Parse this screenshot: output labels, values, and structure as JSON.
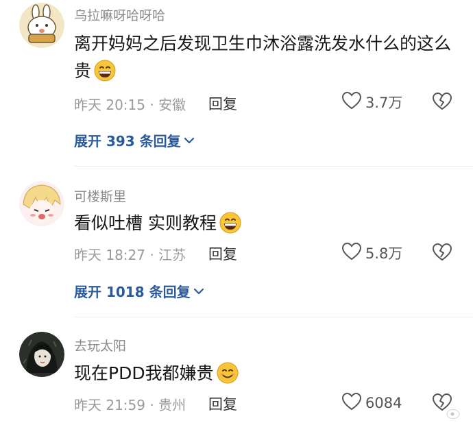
{
  "comments": [
    {
      "username": "乌拉嘛呀哈呀哈",
      "text": "离开妈妈之后发现卫生巾沐浴露洗发水什么的这么贵",
      "time_location": "昨天 20:15 · 安徽",
      "reply_label": "回复",
      "likes": "3.7万",
      "expand_label": "展开 393 条回复",
      "emoji": "grinning-face-icon"
    },
    {
      "username": "可楼斯里",
      "text": "看似吐槽 实则教程",
      "time_location": "昨天 18:27 · 江苏",
      "reply_label": "回复",
      "likes": "5.8万",
      "expand_label": "展开 1018 条回复",
      "emoji": "grinning-face-icon"
    },
    {
      "username": "去玩太阳",
      "text": "现在PDD我都嫌贵",
      "time_location": "昨天 21:59 · 贵州",
      "reply_label": "回复",
      "likes": "6084",
      "emoji": "smiling-face-icon"
    }
  ],
  "colors": {
    "username": "#8a8a8a",
    "body_text": "#161616",
    "meta": "#9a9a9a",
    "expand_link": "#2a5a9a",
    "emoji_face": "#f7c53a"
  }
}
